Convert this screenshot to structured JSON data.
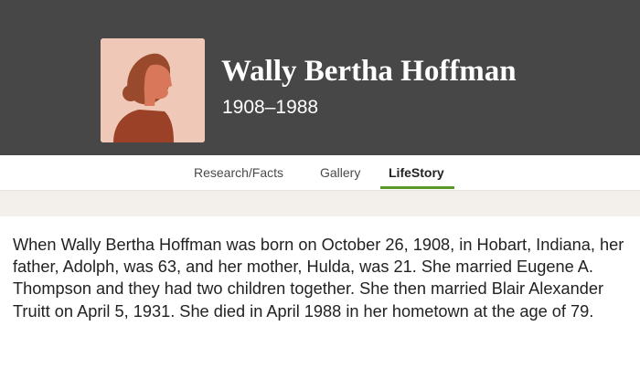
{
  "profile": {
    "name": "Wally Bertha Hoffman",
    "years": "1908–1988",
    "avatar_icon": "female-silhouette-icon"
  },
  "tabs": [
    {
      "label": "Research/Facts",
      "active": false
    },
    {
      "label": "Gallery",
      "active": false
    },
    {
      "label": "LifeStory",
      "active": true
    }
  ],
  "story": {
    "text": "When Wally Bertha Hoffman was born on October 26, 1908, in Hobart, Indiana, her father, Adolph, was 63, and her mother, Hulda, was 21. She married Eugene A. Thompson and they had two children together. She then married Blair Alexander Truitt on April 5, 1931. She died in April 1988 in her hometown at the age of 79."
  },
  "colors": {
    "header_bg": "#474747",
    "avatar_bg": "#f0c8b8",
    "avatar_hair": "#9a4a2c",
    "avatar_skin": "#d9775a",
    "avatar_body": "#9b4128",
    "active_tab_underline": "#5a9a2a",
    "band_bg": "#f3f0eb"
  }
}
